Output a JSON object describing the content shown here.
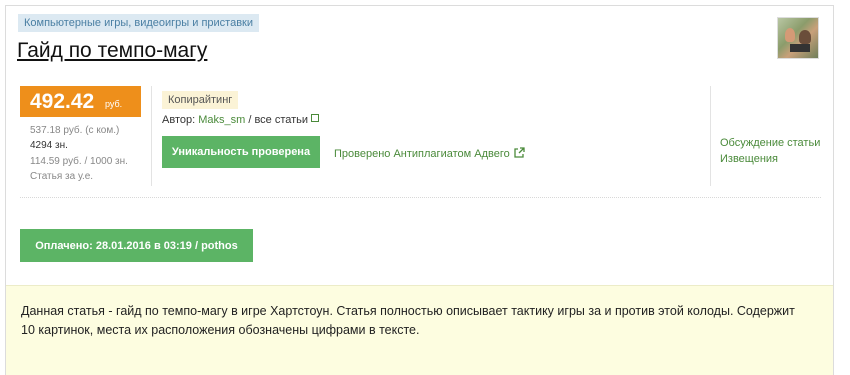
{
  "category": "Компьютерные игры, видеоигры и приставки",
  "title": "Гайд по темпо-магу",
  "price": {
    "value": "492.42",
    "currency": "руб."
  },
  "stats": {
    "per_thousand_with_spaces": "537.18 руб. (с ком.)",
    "chars": "4294 зн.",
    "per_thousand": "114.59 руб. / 1000 зн.",
    "article_ue": "Статья за у.е."
  },
  "tag": "Копирайтинг",
  "author": {
    "label": "Автор:",
    "name": "Maks_sm",
    "all_articles": "/ все статьи"
  },
  "uniqueness_button": "Уникальность проверена",
  "checked_text": "Проверено Антиплагиатом Адвего",
  "right_links": {
    "discussion": "Обсуждение статьи",
    "notices": "Извещения"
  },
  "paid_button": "Оплачено: 28.01.2016 в 03:19 / pothos",
  "description": "Данная статья - гайд по темпо-магу в игре Хартстоун. Статья полностью описывает тактику игры за и против этой колоды. Содержит 10 картинок, места их расположения обозначены цифрами в тексте.",
  "colors": {
    "price_bg": "#ee8f1b",
    "green_button": "#5cb465",
    "link_green": "#4a8a3a",
    "description_bg": "#fdfde0"
  }
}
